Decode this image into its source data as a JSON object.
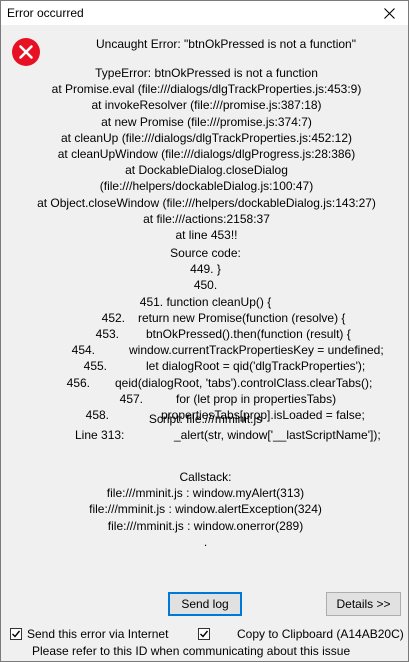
{
  "window": {
    "title": "Error occurred"
  },
  "error": {
    "heading": "Uncaught Error: \"btnOkPressed is not a function\"",
    "trace": [
      "TypeError: btnOkPressed is not a function",
      "at Promise.eval (file:///dialogs/dlgTrackProperties.js:453:9)",
      "at invokeResolver (file:///promise.js:387:18)",
      "at new Promise (file:///promise.js:374:7)",
      "at cleanUp (file:///dialogs/dlgTrackProperties.js:452:12)",
      "at cleanUpWindow (file:///dialogs/dlgProgress.js:28:386)",
      "at DockableDialog.closeDialog",
      "(file:///helpers/dockableDialog.js:100:47)",
      "at Object.closeWindow (file:///helpers/dockableDialog.js:143:27)",
      "at file:///actions:2158:37",
      "at line 453!!"
    ],
    "source_title": "Source code:",
    "source_plain": [
      "449. }",
      "450.",
      "451. function cleanUp() {"
    ],
    "source_lines": [
      {
        "num": "452.",
        "code": "return new Promise(function (resolve) {"
      },
      {
        "num": "453.",
        "code": "btnOkPressed().then(function (result) {"
      },
      {
        "num": "454.",
        "code": "window.currentTrackPropertiesKey = undefined;"
      },
      {
        "num": "455.",
        "code": "let dialogRoot = qid('dlgTrackProperties');"
      },
      {
        "num": "456.",
        "code": "qeid(dialogRoot, 'tabs').controlClass.clearTabs();"
      },
      {
        "num": "457.",
        "code": "for (let prop in propertiesTabs)"
      },
      {
        "num": "458.",
        "code": "propertiesTabs[prop].isLoaded = false;"
      }
    ],
    "script_line": "Script: file:///mminit.js",
    "line_label": "Line 313:",
    "line_code": "_alert(str, window['__lastScriptName']);",
    "callstack_title": "Callstack:",
    "callstack": [
      "file:///mminit.js : window.myAlert(313)",
      "file:///mminit.js : window.alertException(324)",
      "file:///mminit.js : window.onerror(289)",
      "."
    ]
  },
  "buttons": {
    "send_log": "Send log",
    "details": "Details >>"
  },
  "options": {
    "send_via_internet": {
      "label": "Send this error via Internet",
      "checked": true
    },
    "copy_clipboard": {
      "label": "Copy to Clipboard (A14AB20C)",
      "checked": true
    }
  },
  "footer": "Please refer to this ID when communicating about this issue",
  "colors": {
    "error_icon": "#e81123",
    "focus_border": "#0078d7"
  },
  "icons": {
    "close": "close-icon",
    "error": "error-icon",
    "check": "checkmark-icon"
  }
}
